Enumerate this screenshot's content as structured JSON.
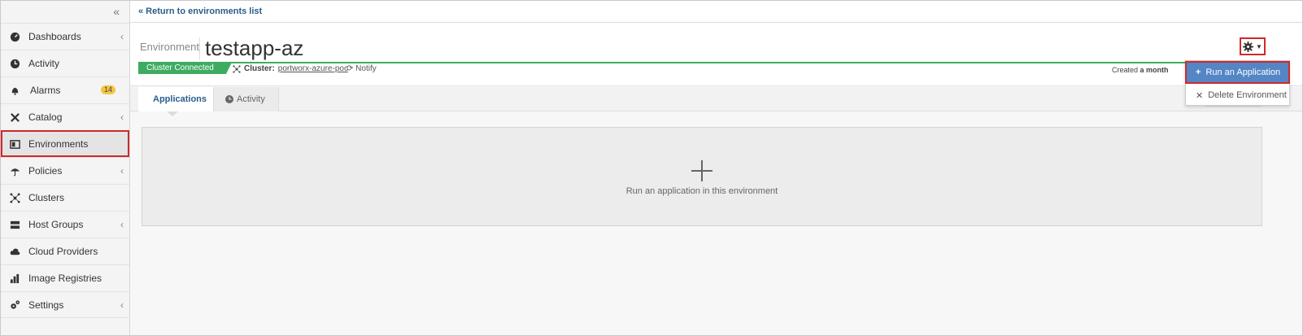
{
  "sidebar": {
    "collapse_glyph": "«",
    "items": [
      {
        "label": "Dashboards",
        "icon": "dashboard-icon",
        "chevron": "‹"
      },
      {
        "label": "Activity",
        "icon": "activity-icon"
      },
      {
        "label": "Alarms",
        "icon": "bell-icon",
        "badge": "14"
      },
      {
        "label": "Catalog",
        "icon": "catalog-icon",
        "chevron": "‹"
      },
      {
        "label": "Environments",
        "icon": "environments-icon",
        "active": true
      },
      {
        "label": "Policies",
        "icon": "umbrella-icon",
        "chevron": "‹"
      },
      {
        "label": "Clusters",
        "icon": "clusters-icon"
      },
      {
        "label": "Host Groups",
        "icon": "server-icon",
        "chevron": "‹"
      },
      {
        "label": "Cloud Providers",
        "icon": "cloud-icon"
      },
      {
        "label": "Image Registries",
        "icon": "registry-icon"
      },
      {
        "label": "Settings",
        "icon": "gears-icon",
        "chevron": "‹"
      }
    ]
  },
  "topbar": {
    "back_link": "« Return to environments list"
  },
  "header": {
    "env_label": "Environment",
    "env_name": "testapp-az",
    "status": "Cluster Connected",
    "cluster_label": "Cluster:",
    "cluster_name": "portworx-azure-poc",
    "notify": "Notify",
    "created_prefix": "Created",
    "created_value": "a month"
  },
  "tabs": [
    {
      "label": "Applications",
      "active": true
    },
    {
      "label": "Activity",
      "active": false
    }
  ],
  "empty_state": {
    "message": "Run an application in this environment"
  },
  "dropdown": {
    "run_label": "Run an Application",
    "delete_label": "Delete Environment"
  },
  "colors": {
    "accent_blue": "#2a5d8c",
    "status_green": "#3eac60",
    "highlight_red": "#d0292b",
    "menu_selected": "#5485c4",
    "badge_yellow": "#f4c542"
  }
}
